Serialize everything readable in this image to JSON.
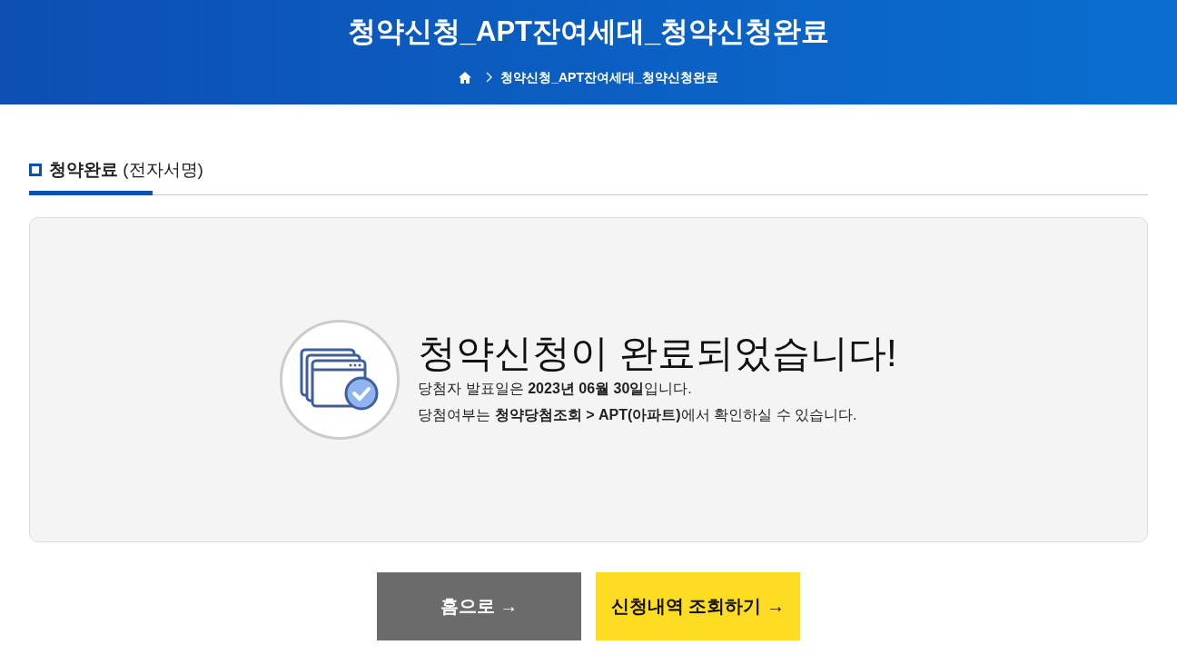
{
  "header": {
    "title": "청약신청_APT잔여세대_청약신청완료",
    "breadcrumb": [
      {
        "label": "청약신청_APT잔여세대_청약신청완료"
      }
    ]
  },
  "section": {
    "title": "**청약완료** (전자서명)"
  },
  "message": {
    "headline": "청약신청이 완료되었습니다!",
    "lines": [
      "당첨자 발표일은 **2023년 06월 30일**입니다.",
      "당첨여부는 **청약당첨조회** **>** **APT(아파트)**에서 확인하실 수 있습니다."
    ]
  },
  "buttons": [
    {
      "label": "홈으로 →",
      "kind": "secondary"
    },
    {
      "label": "신청내역 조회하기 →",
      "kind": "primary"
    }
  ]
}
